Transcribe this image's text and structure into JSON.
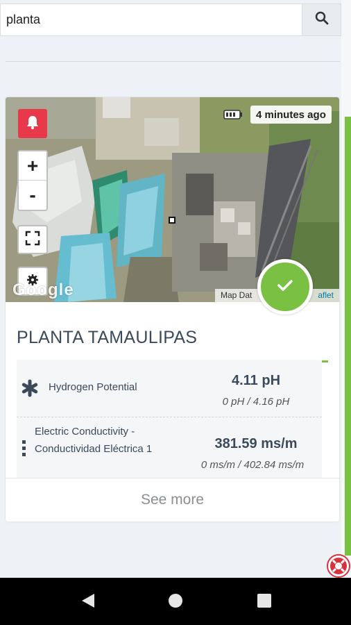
{
  "search": {
    "value": "planta",
    "placeholder": ""
  },
  "card": {
    "map": {
      "time_ago": "4 minutes ago",
      "zoom_in": "+",
      "zoom_out": "-",
      "google_logo": "Google",
      "attribution": "Map Dat",
      "leaflet_link": "aflet"
    },
    "title": "PLANTA TAMAULIPAS",
    "metrics": [
      {
        "icon": "asterisk-icon",
        "label": "Hydrogen Potential",
        "value": "4.11 pH",
        "range": "0 pH / 4.16 pH"
      },
      {
        "icon": "vertical-dots-icon",
        "label": "Electric Conductivity - Conductividad Eléctrica 1",
        "value": "381.59 ms/m",
        "range": "0 ms/m / 402.84 ms/m"
      }
    ],
    "see_more": "See more",
    "status_color": "#7ac043"
  },
  "colors": {
    "accent_green": "#7ac043",
    "alarm_red": "#e8394b",
    "title_text": "#3a4a5c"
  }
}
